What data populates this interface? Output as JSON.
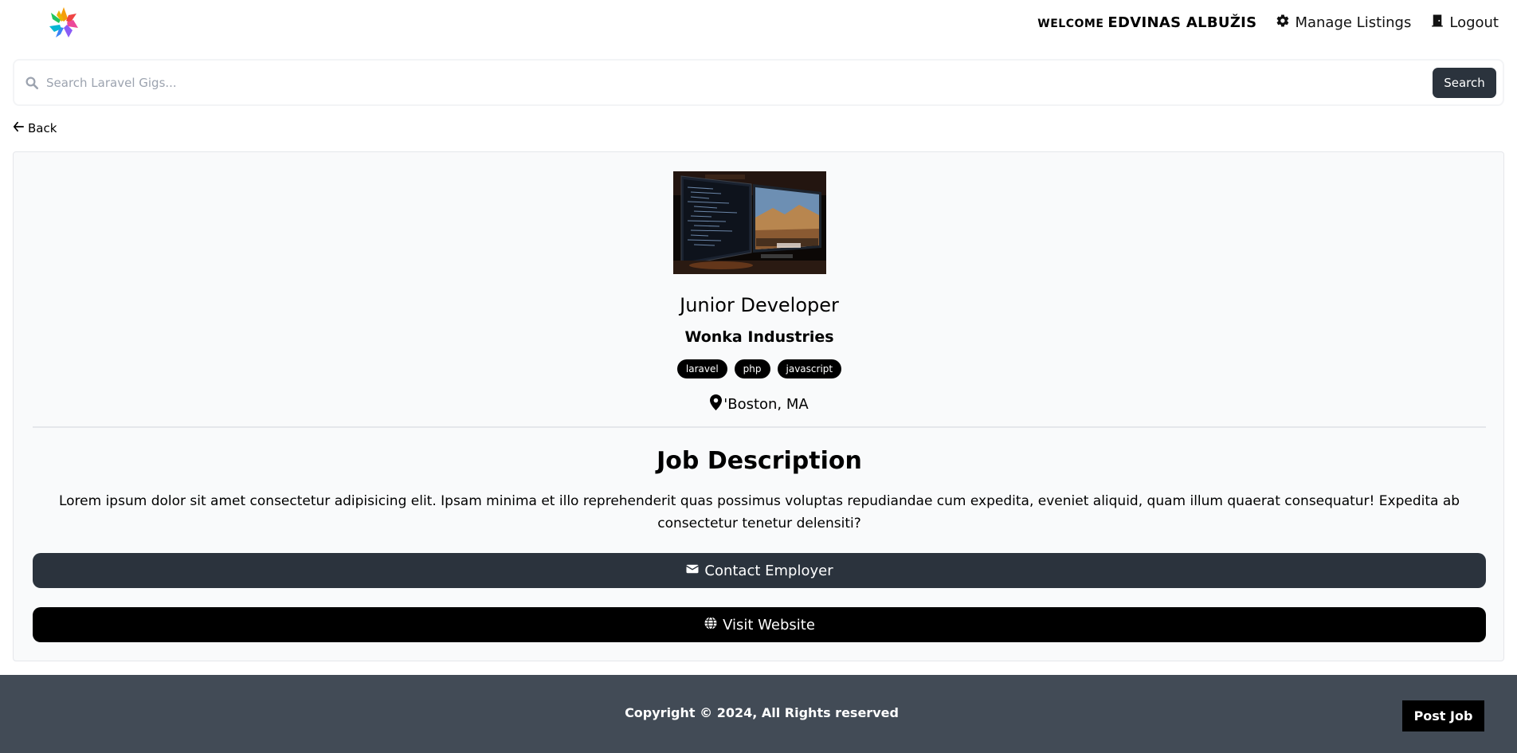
{
  "nav": {
    "welcome_label": "WELCOME",
    "user_name": "EDVINAS ALBUŽIS",
    "manage_listings": "Manage Listings",
    "logout": "Logout",
    "logo_icon": "logo-icon",
    "gear_icon": "gear-icon",
    "door_icon": "door-icon"
  },
  "search": {
    "placeholder": "Search Laravel Gigs...",
    "value": "",
    "button_label": "Search",
    "icon": "search-icon"
  },
  "back": {
    "label": "Back",
    "icon": "arrow-left-icon"
  },
  "listing": {
    "image": "monitors-photo",
    "title": "Junior Developer",
    "company": "Wonka Industries",
    "tags": [
      "laravel",
      "php",
      "javascript"
    ],
    "location": "'Boston, MA",
    "location_icon": "map-pin-icon",
    "description_heading": "Job Description",
    "description": "Lorem ipsum dolor sit amet consectetur adipisicing elit. Ipsam minima et illo reprehenderit quas possimus voluptas repudiandae cum expedita, eveniet aliquid, quam illum quaerat consequatur! Expedita ab consectetur tenetur delensiti?",
    "contact_label": "Contact Employer",
    "contact_icon": "envelope-icon",
    "website_label": "Visit Website",
    "website_icon": "globe-icon"
  },
  "footer": {
    "copyright": "Copyright © 2024, All Rights reserved",
    "post_job": "Post Job"
  },
  "colors": {
    "dark_button": "#2b333d",
    "footer_bg": "#424b56",
    "card_bg": "#f9fafb",
    "black": "#000000"
  }
}
